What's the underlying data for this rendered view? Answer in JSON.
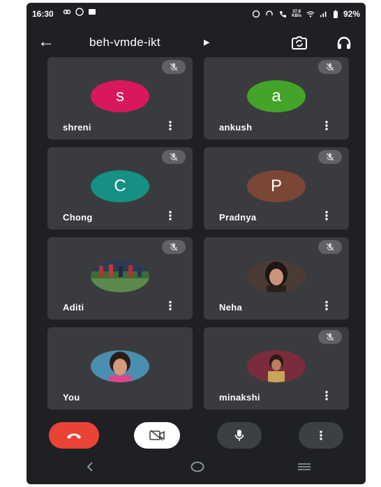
{
  "status_bar": {
    "time": "16:30",
    "speed": "37.8",
    "speed_unit": "KB/s",
    "battery": "92%"
  },
  "meeting": {
    "code": "beh-vmde-ikt"
  },
  "participants": [
    {
      "name": "shreni",
      "initial": "s",
      "avatar_color": "#d8175d",
      "muted": true
    },
    {
      "name": "ankush",
      "initial": "a",
      "avatar_color": "#43a429",
      "muted": true
    },
    {
      "name": "Chong",
      "initial": "C",
      "avatar_color": "#168f84",
      "muted": true
    },
    {
      "name": "Pradnya",
      "initial": "P",
      "avatar_color": "#7a4636",
      "muted": true
    },
    {
      "name": "Aditi",
      "photo": "sports-field-photo",
      "muted": true
    },
    {
      "name": "Neha",
      "photo": "portrait-photo",
      "muted": true
    },
    {
      "name": "You",
      "photo": "portrait-photo",
      "muted": false
    },
    {
      "name": "minakshi",
      "photo": "portrait-photo",
      "muted": true
    }
  ],
  "controls": {
    "end_call_color": "#ea4335",
    "camera_off_bg": "#ffffff",
    "dark_button_bg": "#3c4043"
  },
  "icons": [
    "back-arrow-icon",
    "switch-camera-icon",
    "headset-icon",
    "mic-off-icon",
    "more-vert-icon",
    "end-call-icon",
    "camera-off-icon",
    "mic-icon",
    "nav-back-icon",
    "nav-home-icon",
    "nav-recents-icon"
  ]
}
